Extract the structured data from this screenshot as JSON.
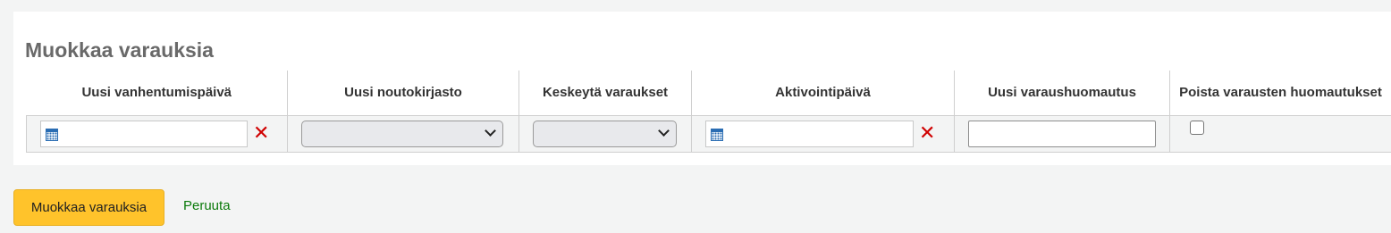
{
  "panel": {
    "title": "Muokkaa varauksia"
  },
  "table": {
    "headers": [
      "Uusi vanhentumispäivä",
      "Uusi noutokirjasto",
      "Keskeytä varaukset",
      "Aktivointipäivä",
      "Uusi varaushuomautus",
      "Poista varausten huomautukset"
    ],
    "expiration_date": {
      "value": "",
      "icon": "calendar-icon",
      "clear_icon": "clear-icon"
    },
    "pickup_library": {
      "selected": ""
    },
    "suspend": {
      "selected": ""
    },
    "activation_date": {
      "value": "",
      "icon": "calendar-icon",
      "clear_icon": "clear-icon"
    },
    "new_note": {
      "value": ""
    },
    "remove_notes": {
      "checked": false
    }
  },
  "actions": {
    "submit_label": "Muokkaa varauksia",
    "cancel_label": "Peruuta"
  },
  "colors": {
    "accent_button": "#ffc32b",
    "clear_icon": "#d00000",
    "link": "#0b7a0b",
    "calendar_icon": "#2a6db3"
  }
}
